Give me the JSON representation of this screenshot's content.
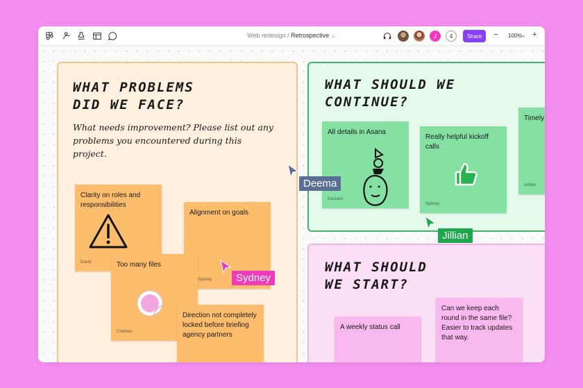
{
  "toolbar": {
    "icons": [
      "figma-menu-icon",
      "pen-tool-icon",
      "stamp-icon",
      "table-icon",
      "comment-icon"
    ],
    "breadcrumb_parent": "Web redesign",
    "breadcrumb_separator": "/",
    "breadcrumb_current": "Retrospective",
    "breadcrumb_chevron": "⌄",
    "audio_icon": "headphones-icon",
    "avatar_initial": "J",
    "collaborator_count": "4",
    "share_label": "Share",
    "zoom_minus": "−",
    "zoom_level": "100%",
    "zoom_chevron": "⌄",
    "zoom_plus": "+",
    "colors": {
      "share": "#8a3ffc",
      "avatar_j": "#f03bbc"
    }
  },
  "sections": {
    "problems": {
      "title": "WHAT PROBLEMS\nDID WE FACE?",
      "subtitle": "What needs improvement? Please list out any problems you encountered during this project.",
      "color": "#fff0df",
      "notes": [
        {
          "text": "Clarity on roles and responsibilities",
          "author": "David",
          "sticker": "warning-icon"
        },
        {
          "text": "Alignment on goals",
          "author": "Sydney"
        },
        {
          "text": "Too many files",
          "author": "Chelsea",
          "sticker": "peel-sticker-icon"
        },
        {
          "text": "Direction not completely locked before briefing agency partners",
          "author": ""
        }
      ]
    },
    "continue": {
      "title": "WHAT SHOULD WE\nCONTINUE?",
      "color": "#e5faea",
      "notes": [
        {
          "text": "All details in Asana",
          "author": "Gustavo",
          "sticker": "face-doodle-icon"
        },
        {
          "text": "Really helpful kickoff calls",
          "author": "Sydney",
          "sticker": "thumbs-up-icon"
        },
        {
          "text": "Timely",
          "author": "Amber"
        }
      ]
    },
    "start": {
      "title": "WHAT SHOULD\nWE START?",
      "color": "#fbdff5",
      "notes": [
        {
          "text": "A weekly status call",
          "author": ""
        },
        {
          "text": "Can we keep each round in the same file? Easier to track updates that way.",
          "author": ""
        }
      ]
    }
  },
  "cursors": [
    {
      "name": "Deema",
      "color": "#5a6f93"
    },
    {
      "name": "Jillian",
      "color": "#1ea84e"
    },
    {
      "name": "Sydney",
      "color": "#f03bbc"
    }
  ]
}
